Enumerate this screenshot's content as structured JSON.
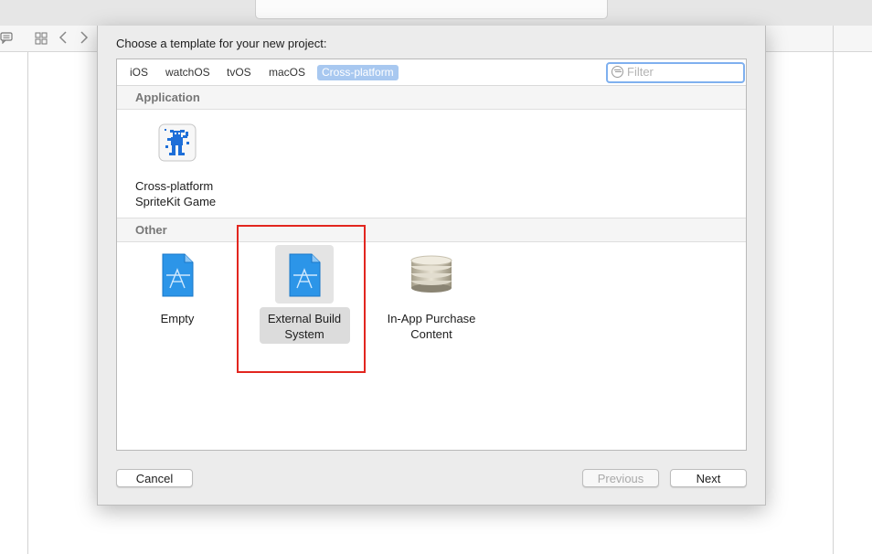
{
  "sheet": {
    "title": "Choose a template for your new project:",
    "tabs": [
      "iOS",
      "watchOS",
      "tvOS",
      "macOS",
      "Cross-platform"
    ],
    "active_tab": "Cross-platform",
    "filter_placeholder": "Filter",
    "sections": {
      "application": {
        "label": "Application",
        "templates": [
          {
            "line1": "Cross-platform",
            "line2": "SpriteKit Game",
            "icon": "spritekit-game-icon"
          }
        ]
      },
      "other": {
        "label": "Other",
        "templates": [
          {
            "line1": "Empty",
            "line2": "",
            "icon": "empty-project-icon"
          },
          {
            "line1": "External Build",
            "line2": "System",
            "icon": "external-build-icon",
            "selected": true
          },
          {
            "line1": "In-App Purchase",
            "line2": "Content",
            "icon": "coins-stack-icon"
          }
        ]
      }
    },
    "buttons": {
      "cancel": "Cancel",
      "previous": "Previous",
      "next": "Next"
    }
  },
  "colors": {
    "accent": "#a8c8f0",
    "highlight_box": "#e2261f",
    "filter_focus": "#7fb0ef"
  }
}
